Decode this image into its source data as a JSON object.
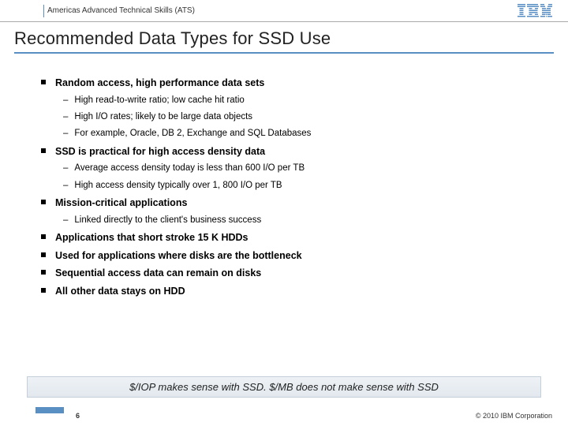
{
  "header": {
    "org": "Americas Advanced Technical Skills (ATS)",
    "logo_name": "ibm-logo"
  },
  "title": "Recommended Data Types for SSD Use",
  "bullets": [
    {
      "text": "Random access, high performance data sets",
      "subs": [
        "High read-to-write ratio;  low cache hit ratio",
        "High I/O rates;  likely to be large data objects",
        "For example, Oracle, DB 2, Exchange and SQL Databases"
      ]
    },
    {
      "text": "SSD is practical for high access density data",
      "subs": [
        "Average access density today is less than 600 I/O per TB",
        "High access density typically over 1, 800 I/O per TB"
      ]
    },
    {
      "text": "Mission-critical applications",
      "subs": [
        "Linked directly to the client's business success"
      ]
    },
    {
      "text": "Applications that short stroke 15 K HDDs",
      "subs": []
    },
    {
      "text": "Used for applications where disks are the bottleneck",
      "subs": []
    },
    {
      "text": "Sequential access data can remain on disks",
      "subs": []
    },
    {
      "text": "All other data stays on HDD",
      "subs": []
    }
  ],
  "callout": "$/IOP makes sense with SSD. $/MB does not make sense with SSD",
  "footer": {
    "page": "6",
    "copyright": "© 2010 IBM Corporation"
  }
}
